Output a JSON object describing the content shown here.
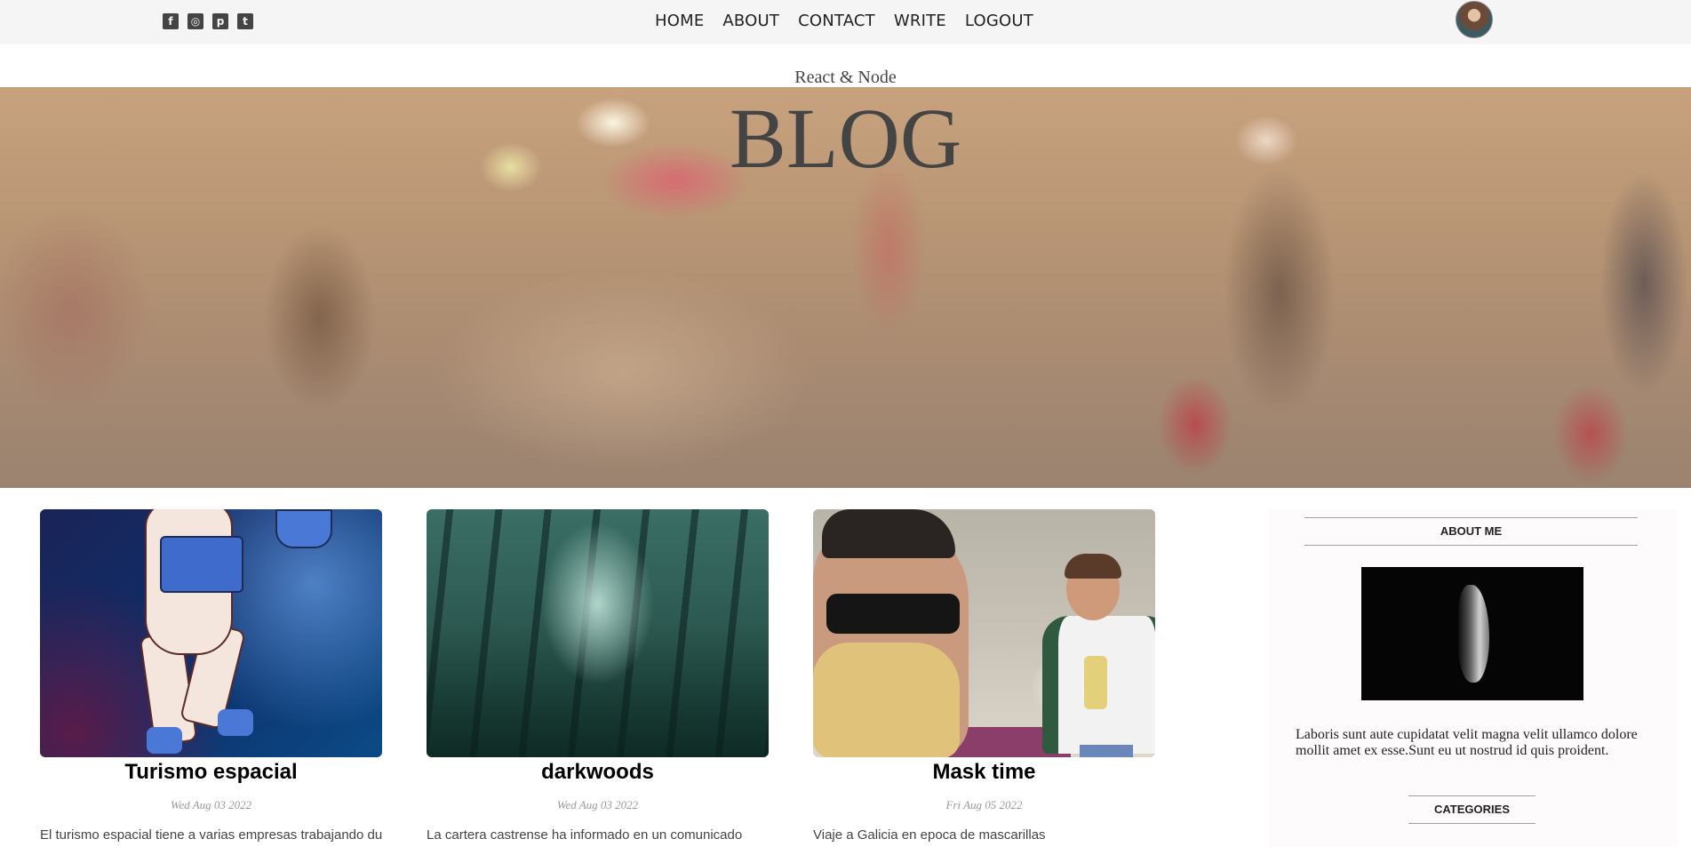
{
  "topbar": {
    "social_icons": [
      "facebook-square-icon",
      "instagram-square-icon",
      "pinterest-square-icon",
      "twitter-square-icon"
    ],
    "nav": [
      "HOME",
      "ABOUT",
      "CONTACT",
      "WRITE",
      "LOGOUT"
    ]
  },
  "header": {
    "subtitle": "React & Node",
    "title": "BLOG"
  },
  "posts": [
    {
      "title": "Turismo espacial",
      "date": "Wed Aug 03 2022",
      "excerpt": "El turismo espacial tiene a varias empresas trabajando duro"
    },
    {
      "title": "darkwoods",
      "date": "Wed Aug 03 2022",
      "excerpt": "La cartera castrense ha informado en un comunicado"
    },
    {
      "title": "Mask time",
      "date": "Fri Aug 05 2022",
      "excerpt": "Viaje a Galicia en epoca de mascarillas"
    }
  ],
  "sidebar": {
    "about_title": "ABOUT ME",
    "about_text": "Laboris sunt aute cupidatat velit magna velit ullamco dolore mollit amet ex esse.Sunt eu ut nostrud id quis proident.",
    "categories_title": "CATEGORIES"
  },
  "colors": {
    "topbar_bg": "#f5f5f5",
    "title_text": "#444444",
    "sidebar_bg": "#fdfbfb"
  }
}
